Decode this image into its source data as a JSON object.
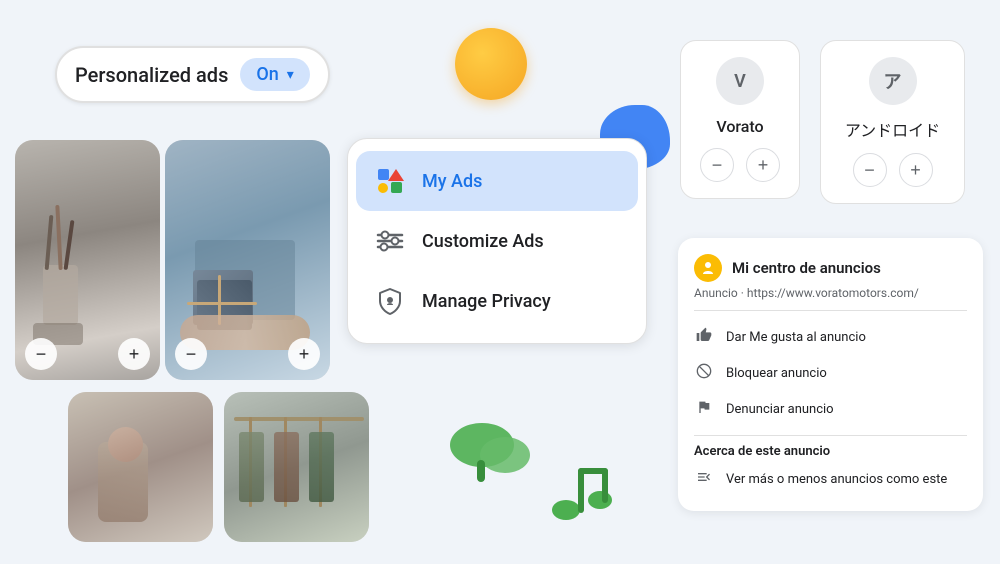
{
  "ads_toggle": {
    "label": "Personalized ads",
    "status": "On",
    "arrow": "▾"
  },
  "menu": {
    "items": [
      {
        "id": "my-ads",
        "label": "My Ads",
        "active": true
      },
      {
        "id": "customize-ads",
        "label": "Customize Ads",
        "active": false
      },
      {
        "id": "manage-privacy",
        "label": "Manage Privacy",
        "active": false
      }
    ]
  },
  "lang_cards": [
    {
      "id": "vorato",
      "letter": "V",
      "name": "Vorato"
    },
    {
      "id": "android-jp",
      "letter": "ア",
      "name": "アンドロイド"
    }
  ],
  "ad_center": {
    "title": "Mi centro de anuncios",
    "subtitle": "Anuncio · https://www.voratomotors.com/",
    "actions": [
      {
        "icon": "👍",
        "label": "Dar Me gusta al anuncio"
      },
      {
        "icon": "🚫",
        "label": "Bloquear anuncio"
      },
      {
        "icon": "🚩",
        "label": "Denunciar anuncio"
      }
    ],
    "section_title": "Acerca de este anuncio",
    "more_action": {
      "icon": "⇅",
      "label": "Ver más o menos anuncios como este"
    }
  },
  "controls": {
    "minus": "−",
    "plus": "+"
  }
}
